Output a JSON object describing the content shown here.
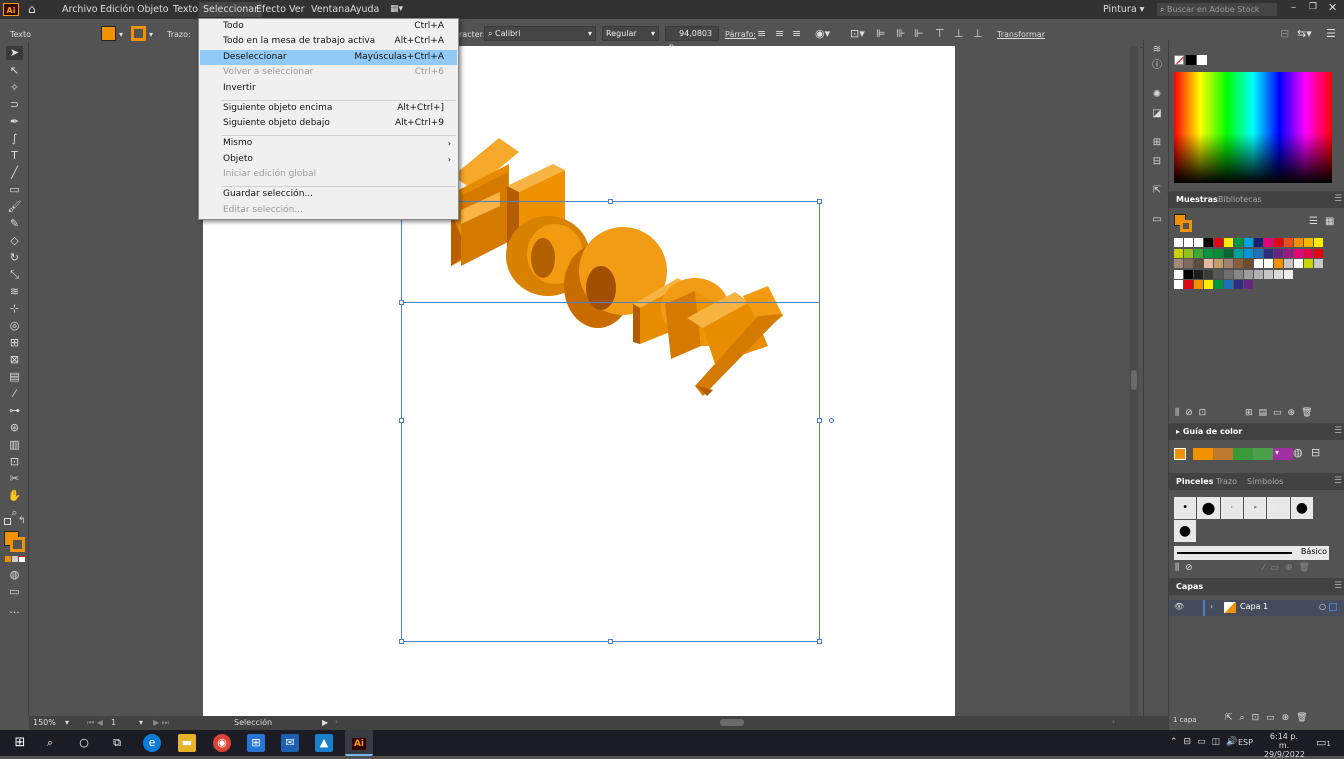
{
  "menubar": {
    "items": [
      "Archivo",
      "Edición",
      "Objeto",
      "Texto",
      "Seleccionar",
      "Efecto",
      "Ver",
      "Ventana",
      "Ayuda"
    ],
    "workspace": "Pintura",
    "search_placeholder": "Buscar en Adobe Stock",
    "logo": "Ai"
  },
  "control": {
    "mode_label": "Texto",
    "stroke_label": "Trazo:",
    "char_label": "racter:",
    "font_name": "Calibri",
    "font_style": "Regular",
    "font_size": "94,0803 p",
    "paragraph_label": "Párrafo:",
    "transform_label": "Transformar"
  },
  "dropdown": {
    "items": [
      {
        "label": "Todo",
        "shortcut": "Ctrl+A",
        "disabled": false
      },
      {
        "label": "Todo en la mesa de trabajo activa",
        "shortcut": "Alt+Ctrl+A",
        "disabled": false
      },
      {
        "label": "Deseleccionar",
        "shortcut": "Mayúsculas+Ctrl+A",
        "disabled": false
      },
      {
        "label": "Volver a seleccionar",
        "shortcut": "Ctrl+6",
        "disabled": true
      },
      {
        "label": "Invertir",
        "shortcut": "",
        "disabled": false
      },
      {
        "label": "Siguiente objeto encima",
        "shortcut": "Alt+Ctrl+]",
        "disabled": false
      },
      {
        "label": "Siguiente objeto debajo",
        "shortcut": "Alt+Ctrl+9",
        "disabled": false
      },
      {
        "label": "Mismo",
        "shortcut": "",
        "disabled": false
      },
      {
        "label": "Objeto",
        "shortcut": "",
        "disabled": false
      },
      {
        "label": "Iniciar edición global",
        "shortcut": "",
        "disabled": true
      },
      {
        "label": "Guardar selección...",
        "shortcut": "",
        "disabled": false
      },
      {
        "label": "Editar selección...",
        "shortcut": "",
        "disabled": true
      }
    ]
  },
  "panels": {
    "muestras": "Muestras",
    "bibliotecas": "Bibliotecas",
    "guia_color": "Guía de color",
    "pinceles": "Pinceles",
    "trazo": "Trazo",
    "simbolos": "Símbolos",
    "basico": "Básico",
    "capas": "Capas",
    "capa1": "Capa 1",
    "capas_count": "1 capa"
  },
  "status": {
    "zoom": "150%",
    "artboard": "1",
    "tool": "Selección"
  },
  "taskbar": {
    "lang": "ESP",
    "time": "6:14 p. m.",
    "date": "29/9/2022",
    "notif": "1"
  },
  "colors": {
    "fill": "#f29200",
    "accent": "#ff9a00",
    "selection": "#4a7fd0",
    "highlight": "#91c9f7"
  },
  "artwork": {
    "text": "ebony"
  }
}
